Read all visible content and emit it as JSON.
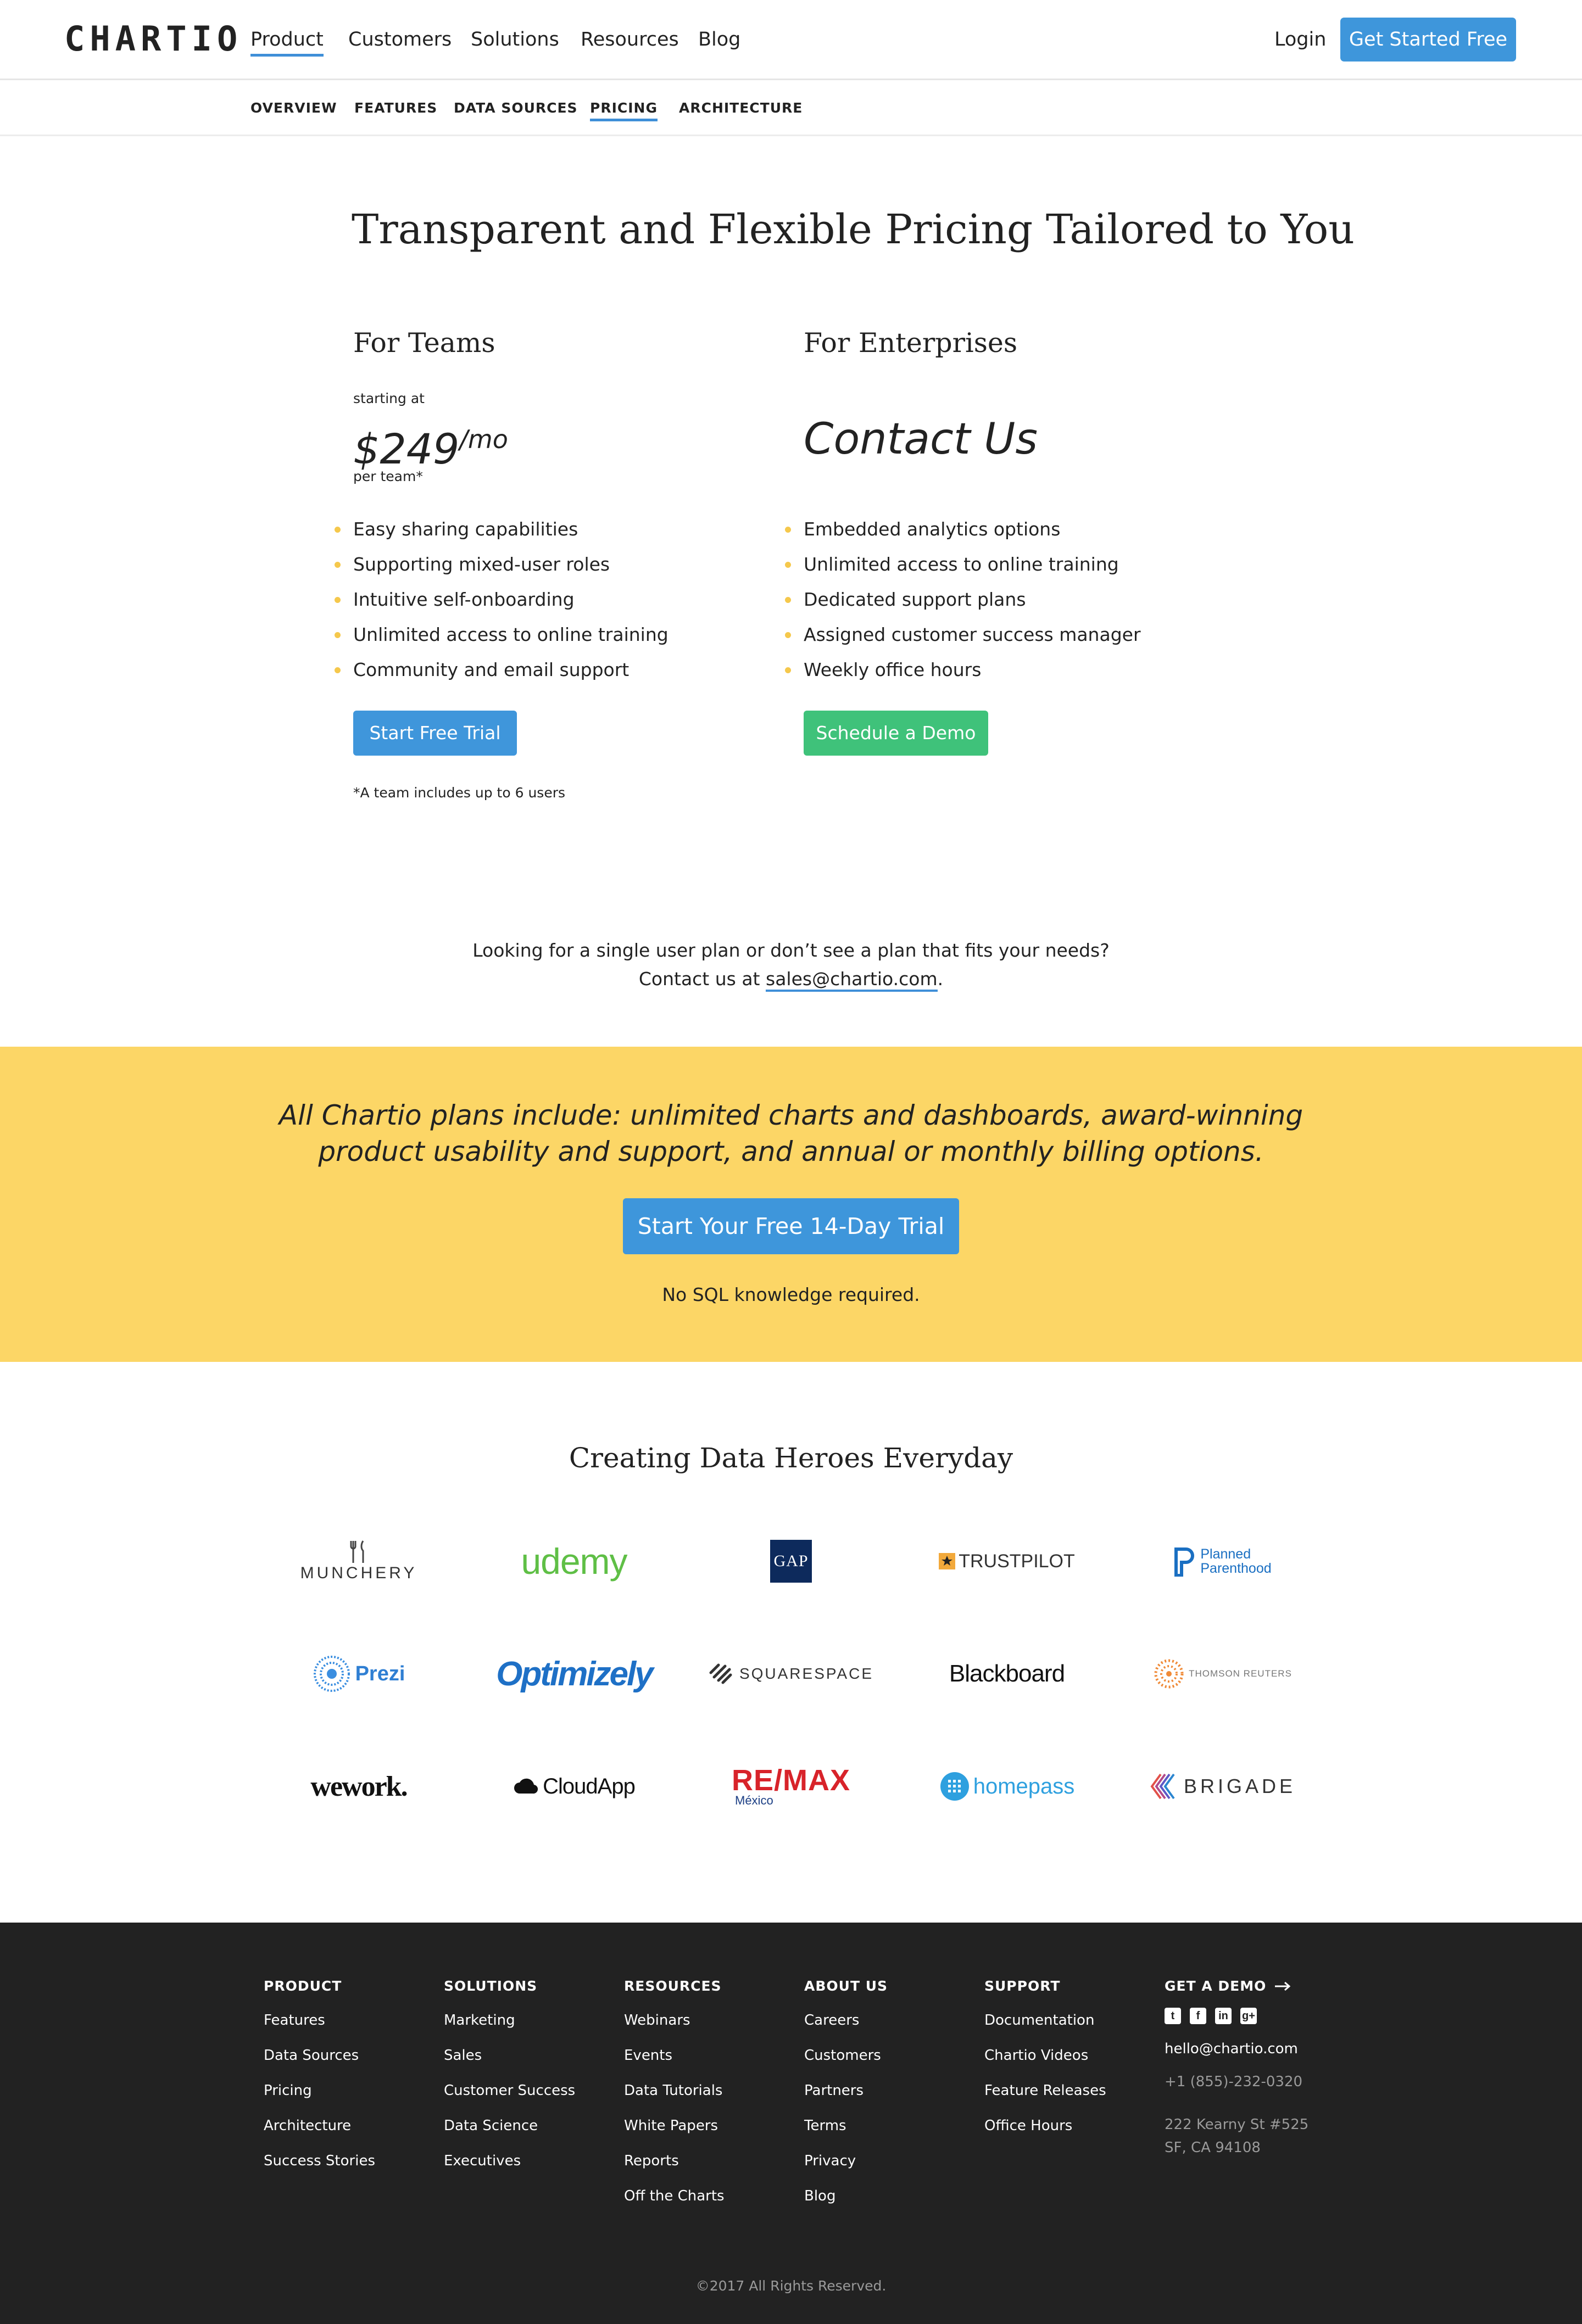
{
  "nav": {
    "logo": "CHARTIO",
    "items": [
      "Product",
      "Customers",
      "Solutions",
      "Resources",
      "Blog"
    ],
    "login": "Login",
    "cta": "Get Started Free"
  },
  "subnav": {
    "items": [
      "OVERVIEW",
      "FEATURES",
      "DATA SOURCES",
      "PRICING",
      "ARCHITECTURE"
    ],
    "active": "PRICING"
  },
  "pricing": {
    "title": "Transparent and Flexible Pricing Tailored to You",
    "teams": {
      "heading": "For Teams",
      "starting_at": "starting at",
      "price": "$249",
      "price_unit": "/mo",
      "per_team": "per team*",
      "features": [
        "Easy sharing capabilities",
        "Supporting mixed-user roles",
        "Intuitive self-onboarding",
        "Unlimited access to online training",
        "Community and email support"
      ],
      "button": "Start Free Trial",
      "note": "*A team includes up to 6 users"
    },
    "enterprise": {
      "heading": "For Enterprises",
      "contact": "Contact Us",
      "features": [
        "Embedded analytics options",
        "Unlimited access to online training",
        "Dedicated support plans",
        "Assigned customer success manager",
        "Weekly office hours"
      ],
      "button": "Schedule a Demo"
    },
    "contact_line1": "Looking for a single user plan or don’t see a plan that fits your needs?",
    "contact_line2_prefix": "Contact us at ",
    "contact_email": "sales@chartio.com",
    "contact_line2_suffix": "."
  },
  "banner": {
    "text": "All Chartio plans include: unlimited charts and dashboards, award-winning product usability and support, and annual or monthly billing options.",
    "button": "Start Your Free 14-Day Trial",
    "note": "No SQL knowledge required."
  },
  "customers": {
    "title": "Creating Data Heroes Everyday",
    "logos": {
      "munchery": "MUNCHERY",
      "udemy": "udemy",
      "gap": "GAP",
      "trustpilot": "TRUSTPILOT",
      "planned_parenthood_1": "Planned",
      "planned_parenthood_2": "Parenthood",
      "prezi": "Prezi",
      "optimizely": "Optimizely",
      "squarespace": "SQUARESPACE",
      "blackboard": "Blackboard",
      "thomson_reuters": "THOMSON REUTERS",
      "wework": "wework.",
      "cloudapp": "CloudApp",
      "remax": "RE/MAX",
      "remax_sub": "México",
      "homepass": "homepass",
      "brigade": "BRIGADE"
    }
  },
  "footer": {
    "columns": [
      {
        "heading": "PRODUCT",
        "links": [
          "Features",
          "Data Sources",
          "Pricing",
          "Architecture",
          "Success Stories"
        ]
      },
      {
        "heading": "SOLUTIONS",
        "links": [
          "Marketing",
          "Sales",
          "Customer Success",
          "Data Science",
          "Executives"
        ]
      },
      {
        "heading": "RESOURCES",
        "links": [
          "Webinars",
          "Events",
          "Data Tutorials",
          "White Papers",
          "Reports",
          "Off the Charts"
        ]
      },
      {
        "heading": "ABOUT US",
        "links": [
          "Careers",
          "Customers",
          "Partners",
          "Terms",
          "Privacy",
          "Blog"
        ]
      },
      {
        "heading": "SUPPORT",
        "links": [
          "Documentation",
          "Chartio Videos",
          "Feature Releases",
          "Office Hours"
        ]
      }
    ],
    "demo_heading": "GET A DEMO",
    "email": "hello@chartio.com",
    "phone": "+1 (855)-232-0320",
    "address1": "222 Kearny St #525",
    "address2": "SF, CA 94108",
    "copyright": "©2017 All Rights Reserved."
  },
  "colors": {
    "primary_blue": "#3e96db",
    "demo_green": "#3fc27a",
    "banner_yellow": "#fcd666",
    "bullet_yellow": "#f5c84c",
    "footer_bg": "#222222"
  }
}
